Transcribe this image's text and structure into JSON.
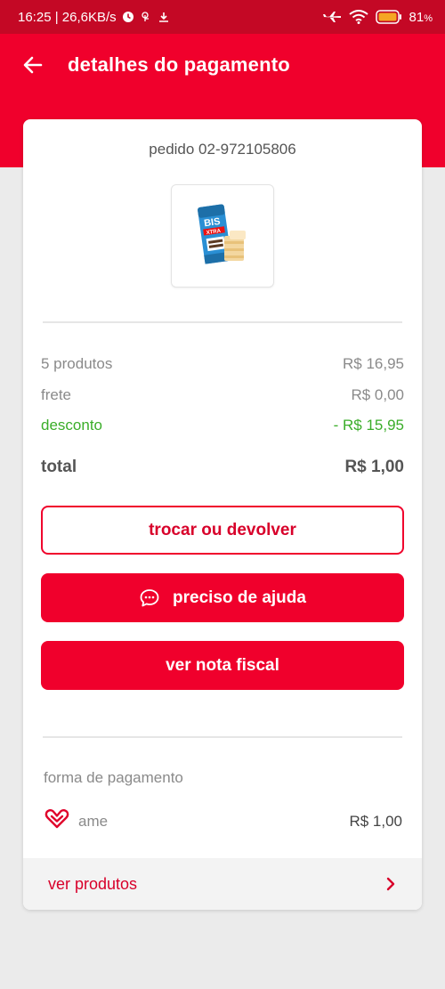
{
  "status_bar": {
    "time_speed": "16:25 | 26,6KB/s",
    "battery": "81",
    "battery_unit": "%"
  },
  "header": {
    "title": "detalhes do pagamento",
    "back_icon": "arrow-left-icon"
  },
  "order": {
    "number": "pedido 02-972105806"
  },
  "summary": {
    "products_label": "5 produtos",
    "products_value": "R$ 16,95",
    "shipping_label": "frete",
    "shipping_value": "R$ 0,00",
    "discount_label": "desconto",
    "discount_value": "- R$ 15,95",
    "total_label": "total",
    "total_value": "R$ 1,00"
  },
  "buttons": {
    "exchange": "trocar ou devolver",
    "help": "preciso de ajuda",
    "invoice": "ver nota fiscal"
  },
  "payment": {
    "label": "forma de pagamento",
    "method": "ame",
    "amount": "R$ 1,00"
  },
  "footer": {
    "label": "ver produtos"
  },
  "colors": {
    "brand": "#f0002c",
    "status_bar": "#c40825",
    "discount": "#3aad29"
  }
}
